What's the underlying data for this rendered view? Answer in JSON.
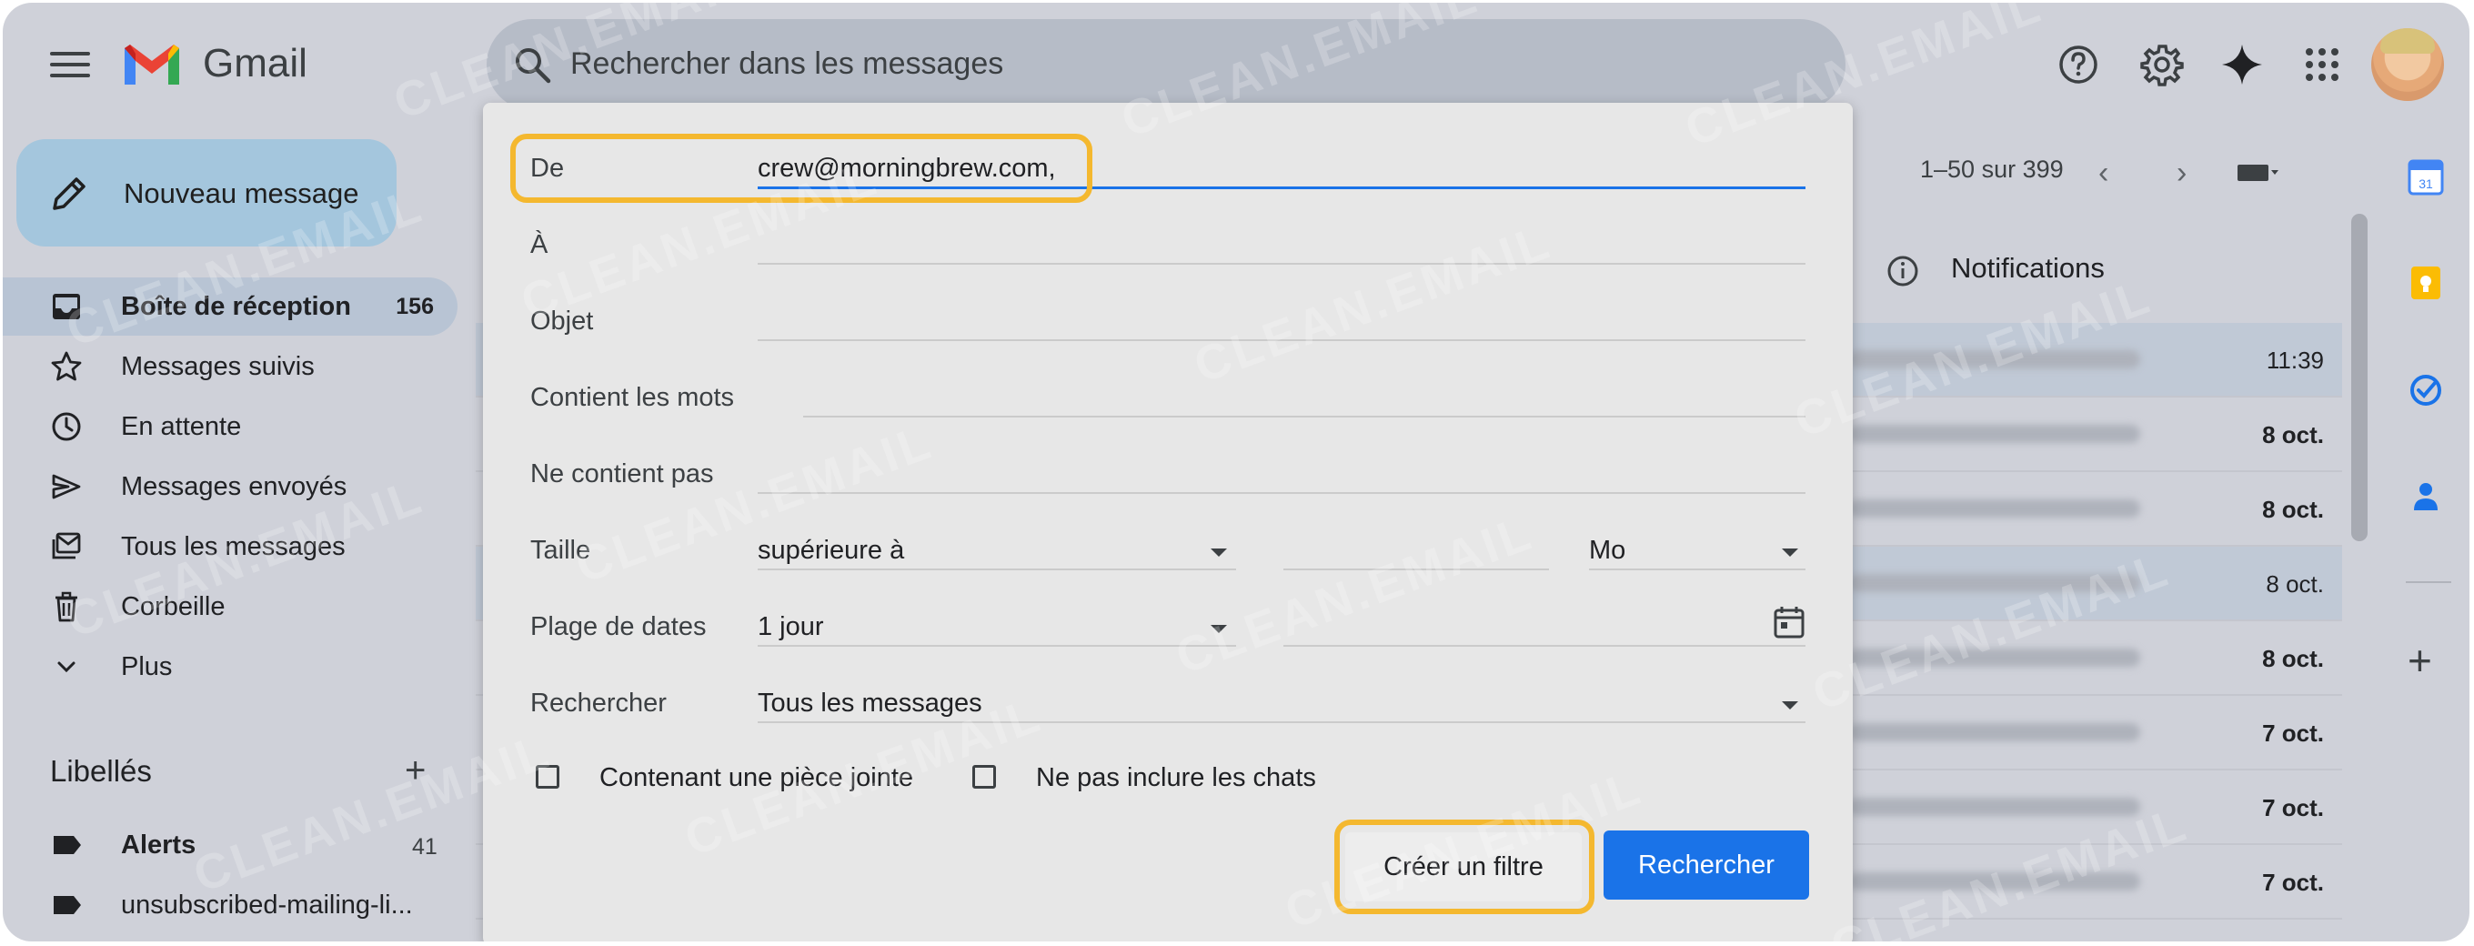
{
  "header": {
    "app_name": "Gmail",
    "search_placeholder": "Rechercher dans les messages"
  },
  "sidebar": {
    "compose_label": "Nouveau message",
    "items": [
      {
        "label": "Boîte de réception",
        "count": "156",
        "icon": "inbox-icon",
        "active": true
      },
      {
        "label": "Messages suivis",
        "icon": "star-icon"
      },
      {
        "label": "En attente",
        "icon": "clock-icon"
      },
      {
        "label": "Messages envoyés",
        "icon": "send-icon"
      },
      {
        "label": "Tous les messages",
        "icon": "all-mail-icon"
      },
      {
        "label": "Corbeille",
        "icon": "trash-icon"
      },
      {
        "label": "Plus",
        "icon": "chevron-down-icon"
      }
    ],
    "labels_title": "Libellés",
    "labels": [
      {
        "name": "Alerts",
        "count": "41"
      },
      {
        "name": "unsubscribed-mailing-li..."
      }
    ]
  },
  "list": {
    "pagination": "1–50 sur 399",
    "notifications_label": "Notifications",
    "rows": [
      {
        "date": "11:39",
        "bold": false,
        "shaded": true
      },
      {
        "date": "8 oct.",
        "bold": true,
        "shaded": false
      },
      {
        "date": "8 oct.",
        "bold": true,
        "shaded": false
      },
      {
        "date": "8 oct.",
        "bold": false,
        "shaded": true
      },
      {
        "date": "8 oct.",
        "bold": true,
        "shaded": false
      },
      {
        "date": "7 oct.",
        "bold": true,
        "shaded": false
      },
      {
        "date": "7 oct.",
        "bold": true,
        "shaded": false
      },
      {
        "date": "7 oct.",
        "bold": true,
        "shaded": false
      }
    ]
  },
  "dialog": {
    "from_label": "De",
    "from_value": "crew@morningbrew.com,",
    "to_label": "À",
    "subject_label": "Objet",
    "has_words_label": "Contient les mots",
    "doesnt_have_label": "Ne contient pas",
    "size_label": "Taille",
    "size_operator": "supérieure à",
    "size_unit": "Mo",
    "date_range_label": "Plage de dates",
    "date_range_value": "1 jour",
    "search_in_label": "Rechercher",
    "search_in_value": "Tous les messages",
    "has_attachment_label": "Contenant une pièce jointe",
    "exclude_chats_label": "Ne pas inclure les chats",
    "create_filter_label": "Créer un filtre",
    "search_button_label": "Rechercher"
  },
  "watermark": "CLEAN.EMAIL",
  "colors": {
    "accent_blue": "#1a73e8",
    "highlight_yellow": "#f4b82f",
    "compose_bg": "#a4c6dd"
  }
}
